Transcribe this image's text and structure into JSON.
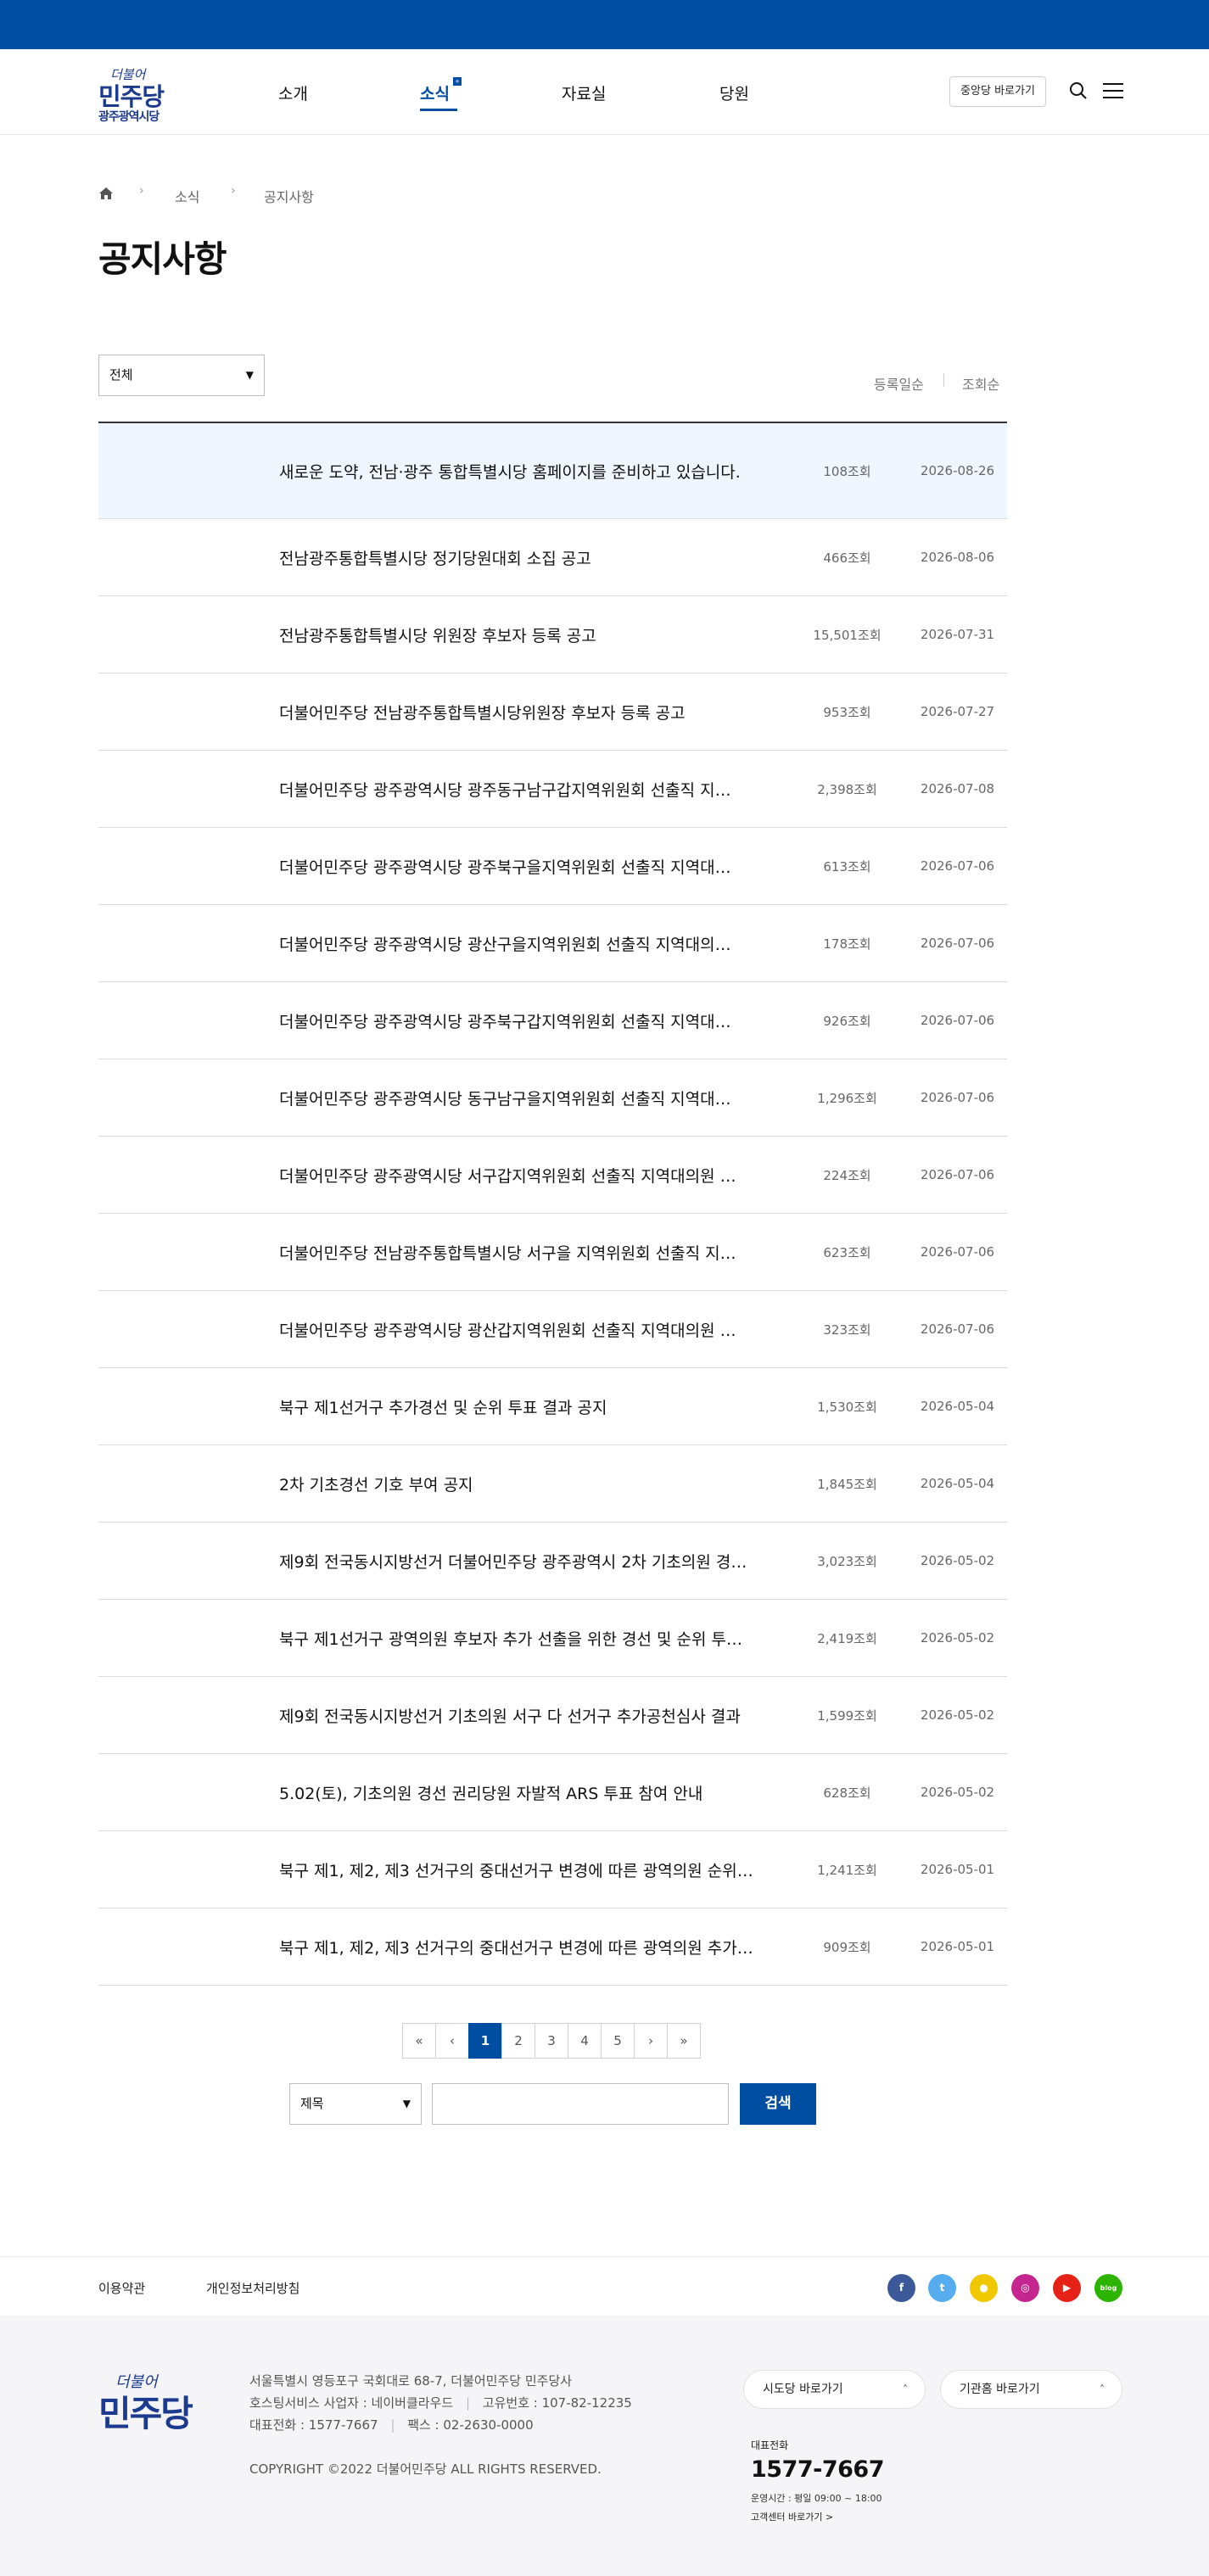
{
  "header": {
    "logo_script": "더불어",
    "logo_main": "민주당",
    "logo_sub": "광주광역시당",
    "nav": [
      {
        "label": "소개"
      },
      {
        "label": "소식"
      },
      {
        "label": "자료실"
      },
      {
        "label": "당원"
      }
    ],
    "hq_button": "중앙당 바로가기",
    "icons": {
      "search": "search-icon",
      "menu": "hamburger-menu-icon",
      "home": "home-icon"
    }
  },
  "breadcrumb": {
    "items": [
      "소식",
      "공지사항"
    ],
    "separator": "›"
  },
  "page_title": "공지사항",
  "filter": {
    "selected": "전체",
    "arrow": "▼"
  },
  "sort": {
    "by_date": "등록일순",
    "by_views": "조회순"
  },
  "notices": [
    {
      "title": "새로운 도약, 전남·광주 통합특별시당 홈페이지를 준비하고 있습니다.",
      "views": "108조회",
      "date": "2026-08-26"
    },
    {
      "title": "전남광주통합특별시당 정기당원대회 소집 공고",
      "views": "466조회",
      "date": "2026-08-06"
    },
    {
      "title": "전남광주통합특별시당 위원장 후보자 등록 공고",
      "views": "15,501조회",
      "date": "2026-07-31"
    },
    {
      "title": "더불어민주당 전남광주통합특별시당위원장 후보자 등록 공고",
      "views": "953조회",
      "date": "2026-07-27"
    },
    {
      "title": "더불어민주당 광주광역시당 광주동구남구갑지역위원회 선출직 지…",
      "views": "2,398조회",
      "date": "2026-07-08"
    },
    {
      "title": "더불어민주당 광주광역시당 광주북구을지역위원회 선출직 지역대…",
      "views": "613조회",
      "date": "2026-07-06"
    },
    {
      "title": "더불어민주당 광주광역시당 광산구을지역위원회 선출직 지역대의…",
      "views": "178조회",
      "date": "2026-07-06"
    },
    {
      "title": "더불어민주당 광주광역시당 광주북구갑지역위원회 선출직 지역대…",
      "views": "926조회",
      "date": "2026-07-06"
    },
    {
      "title": "더불어민주당 광주광역시당 동구남구을지역위원회 선출직 지역대…",
      "views": "1,296조회",
      "date": "2026-07-06"
    },
    {
      "title": "더불어민주당 광주광역시당 서구갑지역위원회 선출직 지역대의원 …",
      "views": "224조회",
      "date": "2026-07-06"
    },
    {
      "title": "더불어민주당 전남광주통합특별시당 서구을 지역위원회 선출직 지…",
      "views": "623조회",
      "date": "2026-07-06"
    },
    {
      "title": "더불어민주당 광주광역시당 광산갑지역위원회 선출직 지역대의원 …",
      "views": "323조회",
      "date": "2026-07-06"
    },
    {
      "title": "북구 제1선거구 추가경선 및 순위 투표 결과 공지",
      "views": "1,530조회",
      "date": "2026-05-04"
    },
    {
      "title": "2차 기초경선 기호 부여 공지",
      "views": "1,845조회",
      "date": "2026-05-04"
    },
    {
      "title": "제9회 전국동시지방선거 더불어민주당 광주광역시 2차 기초의원 경…",
      "views": "3,023조회",
      "date": "2026-05-02"
    },
    {
      "title": "북구 제1선거구 광역의원 후보자 추가 선출을 위한 경선 및 순위 투…",
      "views": "2,419조회",
      "date": "2026-05-02"
    },
    {
      "title": "제9회 전국동시지방선거 기초의원 서구 다 선거구 추가공천심사 결과",
      "views": "1,599조회",
      "date": "2026-05-02"
    },
    {
      "title": "5.02(토), 기초의원 경선 권리당원 자발적 ARS 투표 참여 안내",
      "views": "628조회",
      "date": "2026-05-02"
    },
    {
      "title": "북구 제1, 제2, 제3 선거구의 중대선거구 변경에 따른 광역의원 순위…",
      "views": "1,241조회",
      "date": "2026-05-01"
    },
    {
      "title": "북구 제1, 제2, 제3 선거구의 중대선거구 변경에 따른 광역의원 추가…",
      "views": "909조회",
      "date": "2026-05-01"
    }
  ],
  "pagination": {
    "first": "«",
    "prev": "‹",
    "next": "›",
    "last": "»",
    "pages": [
      "1",
      "2",
      "3",
      "4",
      "5"
    ],
    "current": "1"
  },
  "search": {
    "field_selected": "제목",
    "arrow": "▼",
    "input_value": "",
    "button": "검색"
  },
  "footer": {
    "links": [
      "이용약관",
      "개인정보처리방침"
    ],
    "sns": [
      {
        "name": "facebook-icon",
        "glyph": "f",
        "color": "#3b5998"
      },
      {
        "name": "twitter-icon",
        "glyph": "t",
        "color": "#55acee"
      },
      {
        "name": "kakaotalk-icon",
        "glyph": "●",
        "color": "#f0c800"
      },
      {
        "name": "instagram-icon",
        "glyph": "◎",
        "color": "#c4258f"
      },
      {
        "name": "youtube-icon",
        "glyph": "▶",
        "color": "#e62117"
      },
      {
        "name": "blog-icon",
        "glyph": "blog",
        "color": "#2db400"
      }
    ],
    "logo_script": "더불어",
    "logo_main": "민주당",
    "address": "서울특별시 영등포구 국회대로 68-7, 더불어민주당 민주당사",
    "hosting": "호스팅서비스 사업자 : 네이버클라우드",
    "reg_no": "고유번호 : 107-82-12235",
    "main_tel": "대표전화 : 1577-7667",
    "fax": "팩스 : 02-2630-0000",
    "copyright": "COPYRIGHT ©2022 더불어민주당 ALL RIGHTS RESERVED.",
    "dropdowns": [
      "시도당 바로가기",
      "기관홈 바로가기"
    ],
    "dropdown_arrow": "˄",
    "tel_label": "대표전화",
    "tel": "1577-7667",
    "hours": "운영시간 : 평일 09:00 ~ 18:00",
    "center_link": "고객센터 바로가기 >"
  },
  "colors": {
    "primary": "#004ea2",
    "highlight_row": "#f0f6fd",
    "logo": "#1c3b8f"
  }
}
